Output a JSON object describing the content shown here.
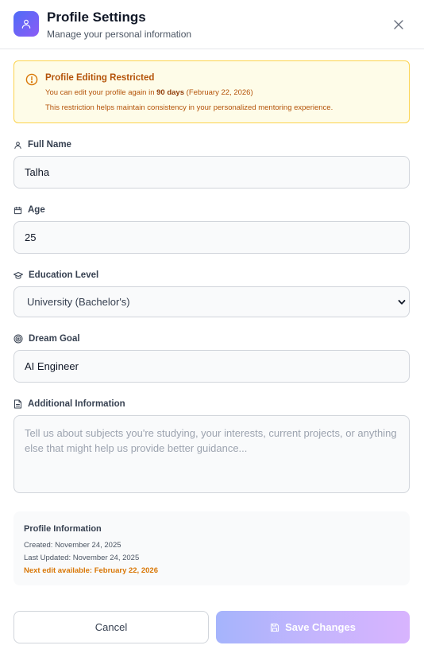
{
  "header": {
    "title": "Profile Settings",
    "subtitle": "Manage your personal information",
    "icon": "user-icon",
    "close_icon": "close-icon",
    "accent_gradient": [
      "#4f6cf7",
      "#8b5cf6"
    ]
  },
  "alert": {
    "icon": "alert-circle-icon",
    "title": "Profile Editing Restricted",
    "line1_prefix": "You can edit your profile again in",
    "line1_days": "90 days",
    "line1_suffix": "(February 22, 2026)",
    "line2": "This restriction helps maintain consistency in your personalized mentoring experience.",
    "color": "#b45309",
    "background": "#fefce8"
  },
  "form": {
    "full_name": {
      "label": "Full Name",
      "icon": "user-icon",
      "value": "Talha"
    },
    "age": {
      "label": "Age",
      "icon": "calendar-icon",
      "value": "25"
    },
    "education": {
      "label": "Education Level",
      "icon": "graduation-cap-icon",
      "value": "University (Bachelor's)"
    },
    "dream_goal": {
      "label": "Dream Goal",
      "icon": "target-icon",
      "value": "AI Engineer"
    },
    "additional": {
      "label": "Additional Information",
      "icon": "file-text-icon",
      "value": "",
      "placeholder": "Tell us about subjects you're studying, your interests, current projects, or anything else that might help us provide better guidance..."
    }
  },
  "profile_info": {
    "title": "Profile Information",
    "created": "Created: November 24, 2025",
    "updated": "Last Updated: November 24, 2025",
    "next_edit": "Next edit available: February 22, 2026"
  },
  "actions": {
    "cancel_label": "Cancel",
    "save_label": "Save Changes",
    "save_icon": "save-icon"
  }
}
